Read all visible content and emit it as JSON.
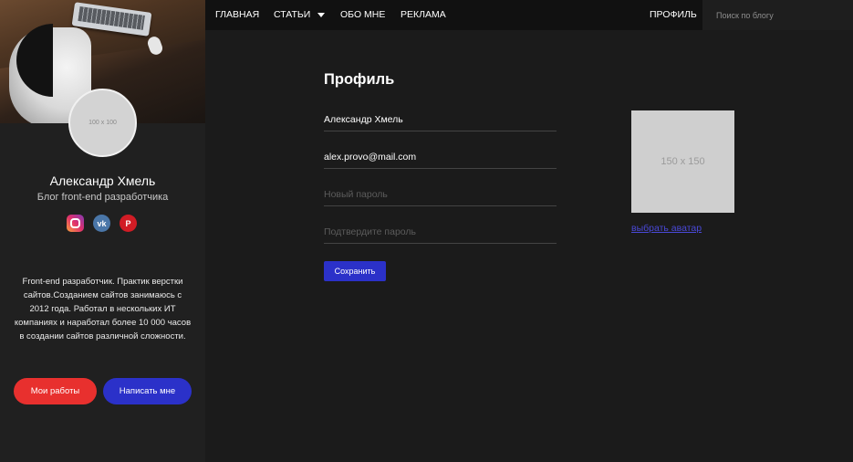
{
  "nav": {
    "items": [
      {
        "label": "Главная"
      },
      {
        "label": "Статьи"
      },
      {
        "label": "Обо мне"
      },
      {
        "label": "Реклама"
      }
    ],
    "profile_label": "Профиль",
    "search_placeholder": "Поиск по блогу"
  },
  "sidebar": {
    "avatar_text": "100 x 100",
    "name": "Александр Хмель",
    "subtitle": "Блог front-end разработчика",
    "socials": [
      "instagram-icon",
      "vk-icon",
      "pinterest-icon"
    ],
    "about": "Front-end разработчик. Практик верстки сайтов.Созданием сайтов занимаюсь с 2012 года. Работал в нескольких ИТ компаниях и наработал более 10 000 часов в создании сайтов различной сложности.",
    "buttons": {
      "works": "Мои работы",
      "write": "Написать мне"
    }
  },
  "form": {
    "title": "Профиль",
    "name_value": "Александр Хмель",
    "email_value": "alex.provo@mail.com",
    "new_password_placeholder": "Новый пароль",
    "confirm_password_placeholder": "Подтвердите пароль",
    "save_label": "Сохранить",
    "avatar_placeholder": "150 x 150",
    "choose_avatar": "выбрать аватар"
  },
  "colors": {
    "accent_blue": "#2b31c9",
    "accent_red": "#e8302e",
    "background": "#1b1b1b",
    "sidebar": "#202020",
    "nav": "#111111"
  }
}
